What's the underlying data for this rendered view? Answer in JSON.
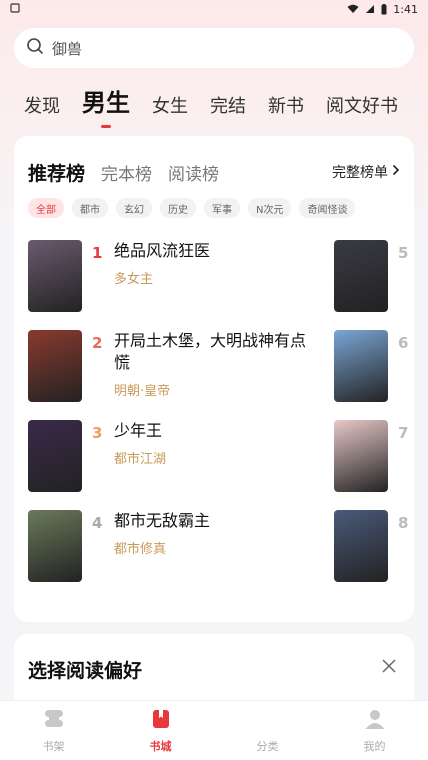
{
  "status_bar": {
    "time": "1:41"
  },
  "search": {
    "placeholder": "御兽"
  },
  "tabs": [
    {
      "label": "发现",
      "active": false
    },
    {
      "label": "男生",
      "active": true
    },
    {
      "label": "女生",
      "active": false
    },
    {
      "label": "完结",
      "active": false
    },
    {
      "label": "新书",
      "active": false
    },
    {
      "label": "阅文好书",
      "active": false
    }
  ],
  "ranking": {
    "tabs": [
      {
        "label": "推荐榜",
        "active": true
      },
      {
        "label": "完本榜",
        "active": false
      },
      {
        "label": "阅读榜",
        "active": false
      }
    ],
    "full_list_label": "完整榜单",
    "chips": [
      {
        "label": "全部",
        "active": true
      },
      {
        "label": "都市",
        "active": false
      },
      {
        "label": "玄幻",
        "active": false
      },
      {
        "label": "历史",
        "active": false
      },
      {
        "label": "军事",
        "active": false
      },
      {
        "label": "N次元",
        "active": false
      },
      {
        "label": "奇闻怪谈",
        "active": false
      }
    ],
    "books": [
      {
        "rank": "1",
        "title": "绝品风流狂医",
        "category": "多女主",
        "rank_color": "#e8383d",
        "cover_color": "#6b5a6e"
      },
      {
        "rank": "2",
        "title": "开局土木堡，大明战神有点慌",
        "category": "明朝·皇帝",
        "rank_color": "#ec6a5c",
        "cover_color": "#8a3a2e"
      },
      {
        "rank": "3",
        "title": "少年王",
        "category": "都市江湖",
        "rank_color": "#f0a05a",
        "cover_color": "#3a2a4a"
      },
      {
        "rank": "4",
        "title": "都市无敌霸主",
        "category": "都市修真",
        "rank_color": "#aaaaaa",
        "cover_color": "#6a7a5a"
      }
    ],
    "side_books": [
      {
        "rank": "5",
        "cover_color": "#3a3a44"
      },
      {
        "rank": "6",
        "cover_color": "#7aa6d6"
      },
      {
        "rank": "7",
        "cover_color": "#e8c8c8"
      },
      {
        "rank": "8",
        "cover_color": "#4a5a7a"
      }
    ]
  },
  "preference": {
    "title": "选择阅读偏好"
  },
  "bottom_nav": [
    {
      "label": "书架",
      "icon": "bookshelf-icon",
      "active": false
    },
    {
      "label": "书城",
      "icon": "bookstore-icon",
      "active": true
    },
    {
      "label": "分类",
      "icon": "category-icon",
      "active": false
    },
    {
      "label": "我的",
      "icon": "profile-icon",
      "active": false
    }
  ],
  "colors": {
    "accent": "#e8383d",
    "category": "#c89a5a"
  }
}
